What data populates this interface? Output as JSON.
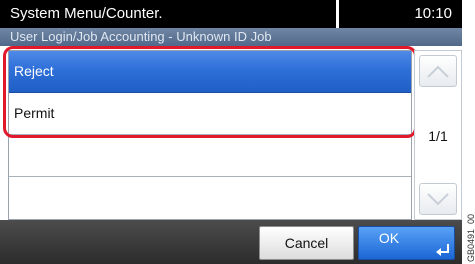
{
  "header": {
    "title": "System Menu/Counter.",
    "time": "10:10",
    "breadcrumb": "User Login/Job Accounting - Unknown ID Job"
  },
  "list": {
    "options": [
      {
        "label": "Reject",
        "selected": true
      },
      {
        "label": "Permit",
        "selected": false
      }
    ]
  },
  "scroll": {
    "page": "1/1",
    "up_icon": "chevron-up-icon",
    "down_icon": "chevron-down-icon"
  },
  "footer": {
    "cancel_label": "Cancel",
    "ok_label": "OK",
    "ok_icon": "enter-icon"
  },
  "side_code": "GB0491_00",
  "colors": {
    "selection": "#2e6fd8",
    "highlight_frame": "#e0192b",
    "header_bg": "#000000",
    "breadcrumb_bg": "#5f7797",
    "footer_bg": "#3a3a3a",
    "ok_button": "#2a78e0"
  }
}
